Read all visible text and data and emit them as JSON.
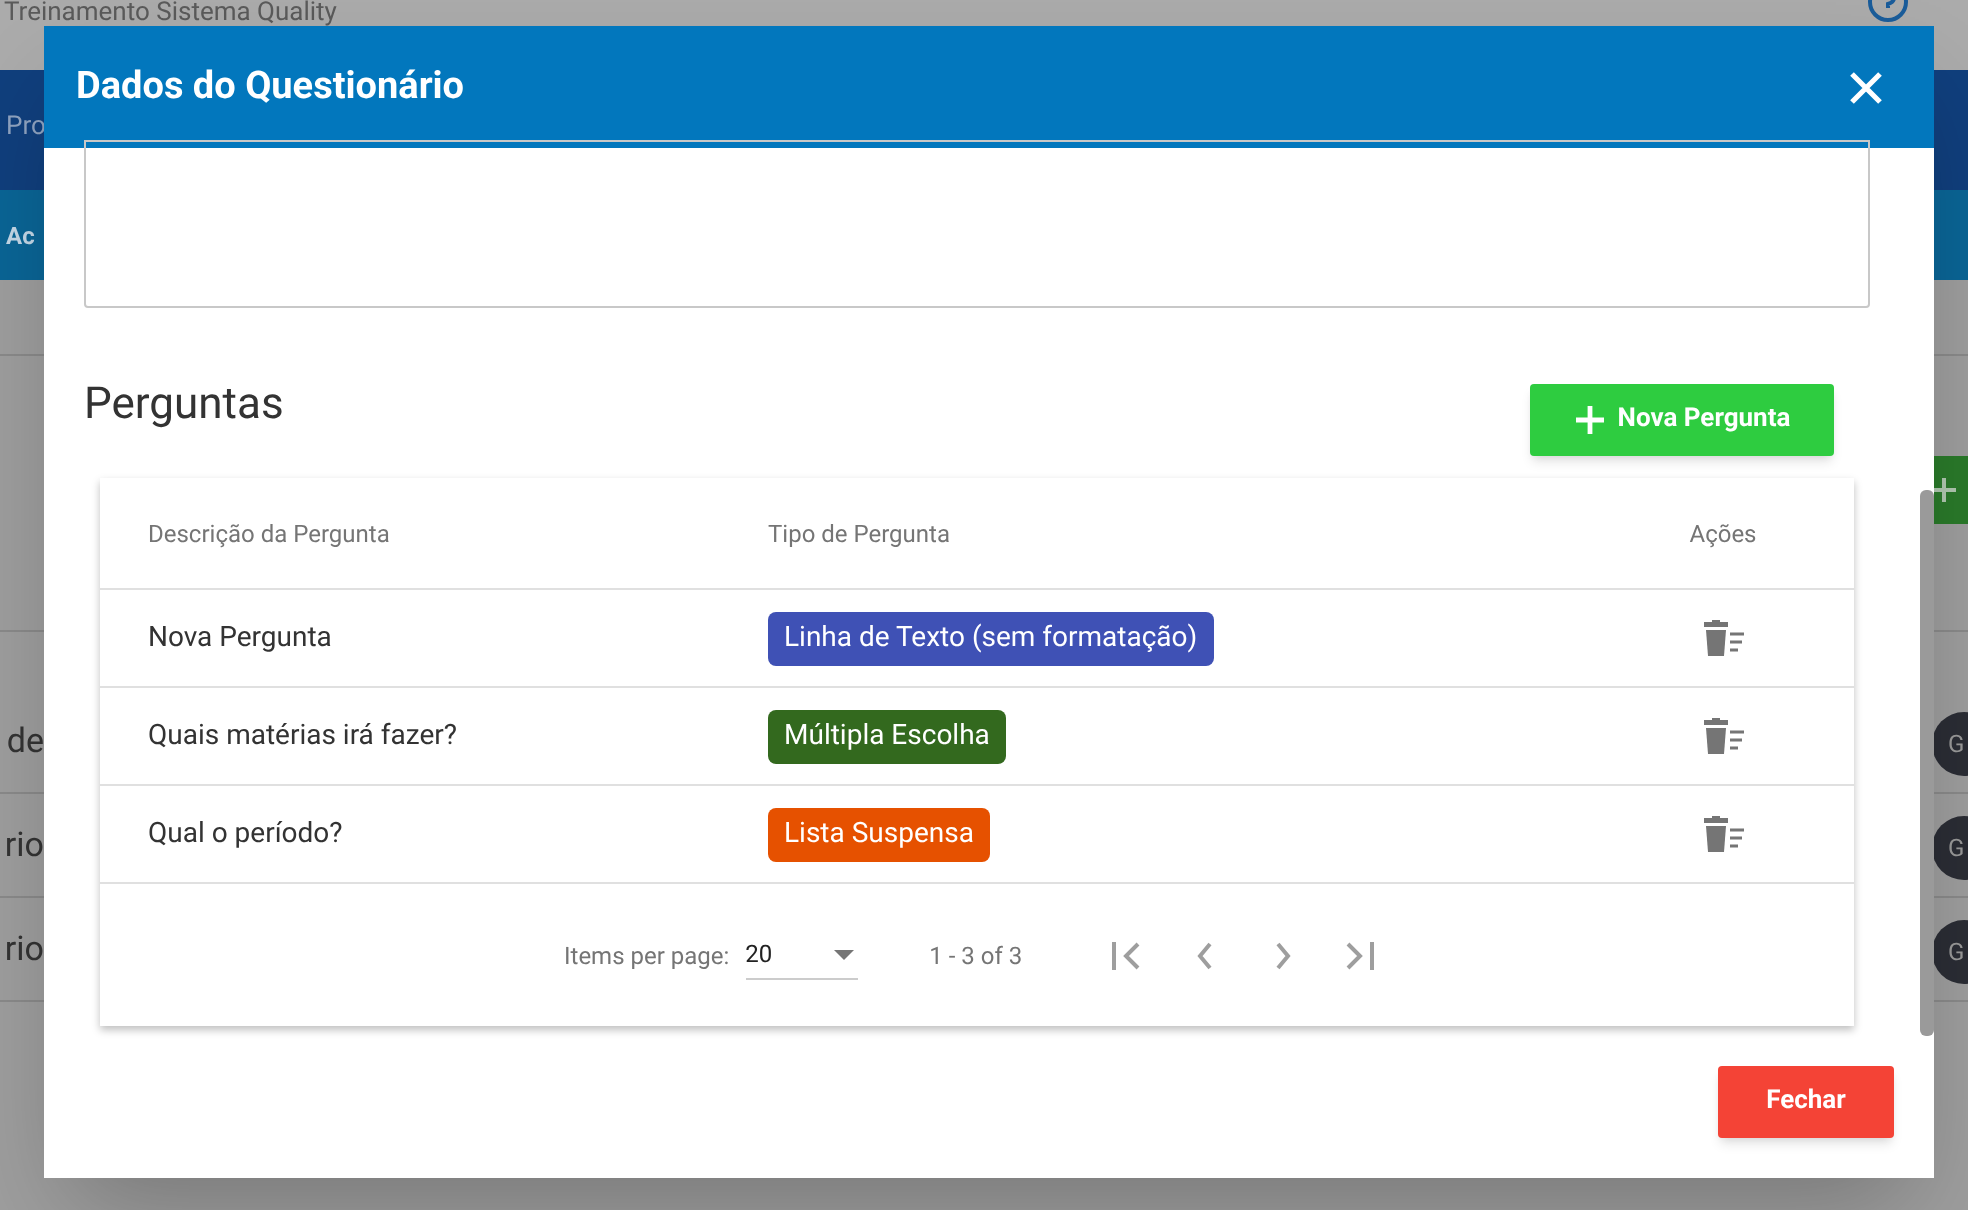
{
  "background": {
    "app_title": "Treinamento Sistema Quality",
    "nav_label": "Pro",
    "subnav_label": "Ac",
    "row_labels": [
      "de",
      "rio",
      "rio"
    ],
    "row_badges": [
      "G",
      "G",
      "G"
    ]
  },
  "dialog": {
    "title": "Dados do Questionário",
    "section_title": "Perguntas",
    "new_button": "Nova Pergunta",
    "table": {
      "columns": [
        "Descrição da Pergunta",
        "Tipo de Pergunta",
        "Ações"
      ],
      "rows": [
        {
          "description": "Nova Pergunta",
          "type": "Linha de Texto (sem formatação)",
          "color": "#3f51b5"
        },
        {
          "description": "Quais matérias irá fazer?",
          "type": "Múltipla Escolha",
          "color": "#33691e"
        },
        {
          "description": "Qual o período?",
          "type": "Lista Suspensa",
          "color": "#e65100"
        }
      ]
    },
    "paginator": {
      "label": "Items per page:",
      "page_size": "20",
      "range": "1 - 3 of 3"
    },
    "close_button": "Fechar"
  }
}
